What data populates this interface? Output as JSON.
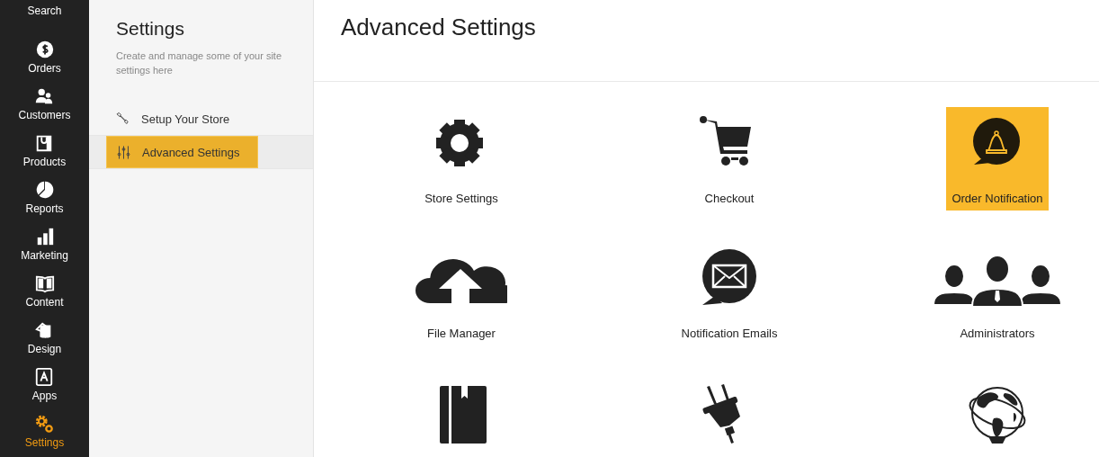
{
  "nav": [
    {
      "label": "Search",
      "selected": false
    },
    {
      "label": "Orders",
      "selected": false
    },
    {
      "label": "Customers",
      "selected": false
    },
    {
      "label": "Products",
      "selected": false
    },
    {
      "label": "Reports",
      "selected": false
    },
    {
      "label": "Marketing",
      "selected": false
    },
    {
      "label": "Content",
      "selected": false
    },
    {
      "label": "Design",
      "selected": false
    },
    {
      "label": "Apps",
      "selected": false
    },
    {
      "label": "Settings",
      "selected": true
    }
  ],
  "settings_panel": {
    "title": "Settings",
    "description": "Create and manage some of your site settings here",
    "items": [
      {
        "label": "Setup Your Store",
        "selected": false
      },
      {
        "label": "Advanced Settings",
        "selected": true
      }
    ]
  },
  "page_title": "Advanced Settings",
  "tiles": [
    {
      "label": "Store Settings",
      "selected": false
    },
    {
      "label": "Checkout",
      "selected": false
    },
    {
      "label": "Order Notification",
      "selected": true
    },
    {
      "label": "File Manager",
      "selected": false
    },
    {
      "label": "Notification Emails",
      "selected": false
    },
    {
      "label": "Administrators",
      "selected": false
    },
    {
      "selected": false
    },
    {
      "selected": false
    },
    {
      "selected": false
    }
  ]
}
